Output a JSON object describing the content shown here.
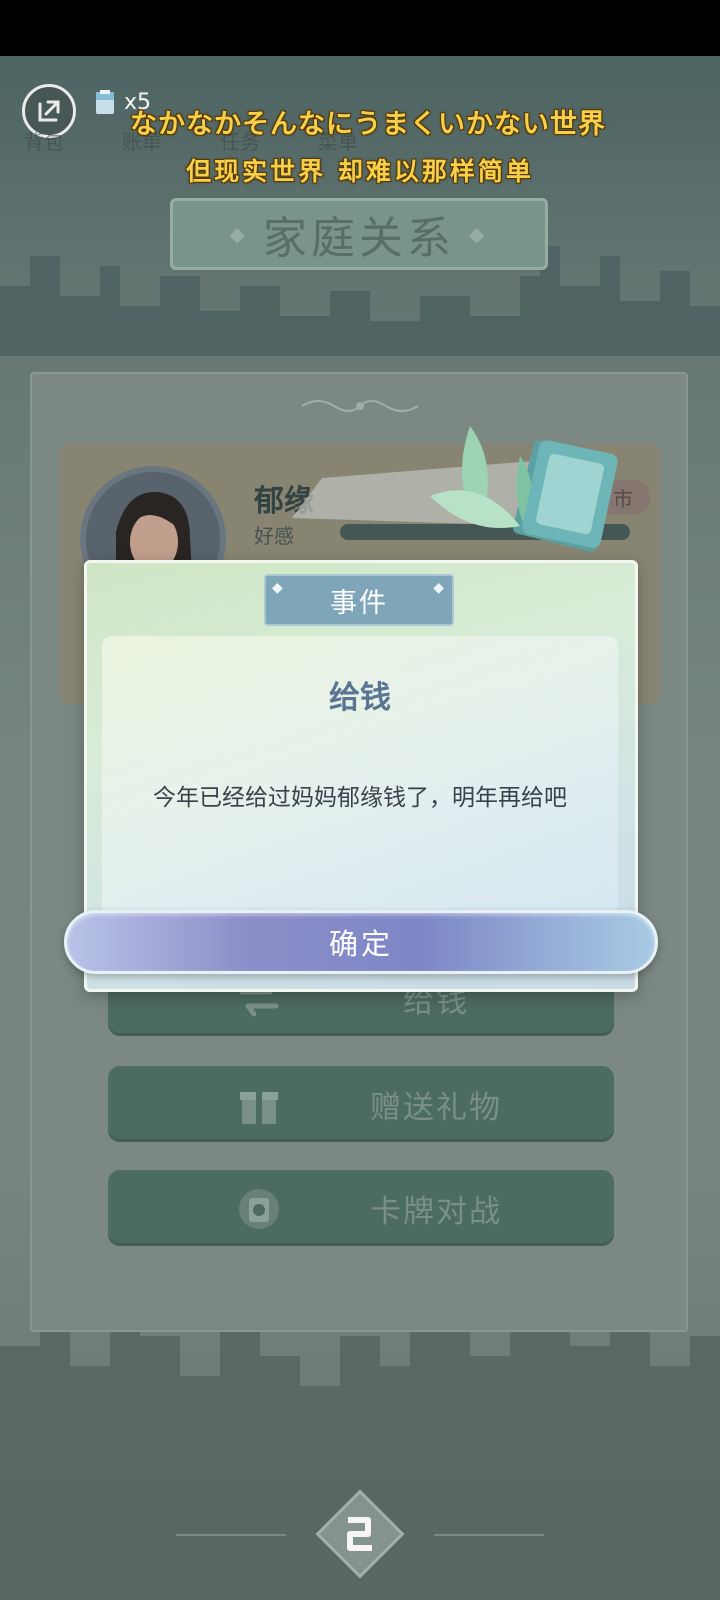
{
  "header": {
    "ticket_count": "x5",
    "tabs": [
      "背包",
      "账单",
      "任务",
      "菜单"
    ],
    "top_number": "2",
    "lyric_line_1": "なかなかそんなにうまくいかない世界",
    "lyric_line_2": "但现实世界 却难以那样简单"
  },
  "page": {
    "title": "家庭关系"
  },
  "character": {
    "name": "郁缘",
    "stat_label": "好感",
    "tag": "市"
  },
  "actions": [
    {
      "label": "给钱",
      "icon": "exchange-icon"
    },
    {
      "label": "赠送礼物",
      "icon": "gift-icon"
    },
    {
      "label": "卡牌对战",
      "icon": "card-icon"
    }
  ],
  "dialog": {
    "tag": "事件",
    "title": "给钱",
    "message": "今年已经给过妈妈郁缘钱了，明年再给吧",
    "confirm_label": "确定"
  },
  "colors": {
    "lyric": "#ffd84a",
    "dialog_tag": "#7fa6b8",
    "confirm": "#7d86c6",
    "action_button": "#4f6f64"
  }
}
